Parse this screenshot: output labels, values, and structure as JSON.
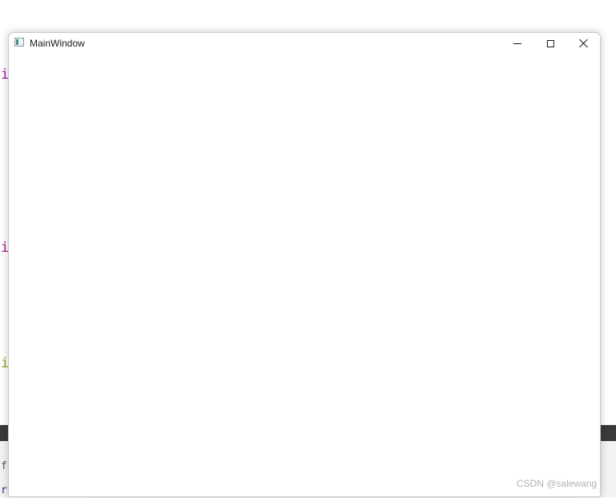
{
  "background_editor": {
    "glyphs": [
      "i",
      "i",
      "i",
      "f",
      "r"
    ]
  },
  "window": {
    "title": "MainWindow",
    "icon": "app-window-icon",
    "controls": {
      "minimize_icon": "minimize-icon",
      "maximize_icon": "maximize-icon",
      "close_icon": "close-icon"
    }
  },
  "watermark": "CSDN @salewang"
}
